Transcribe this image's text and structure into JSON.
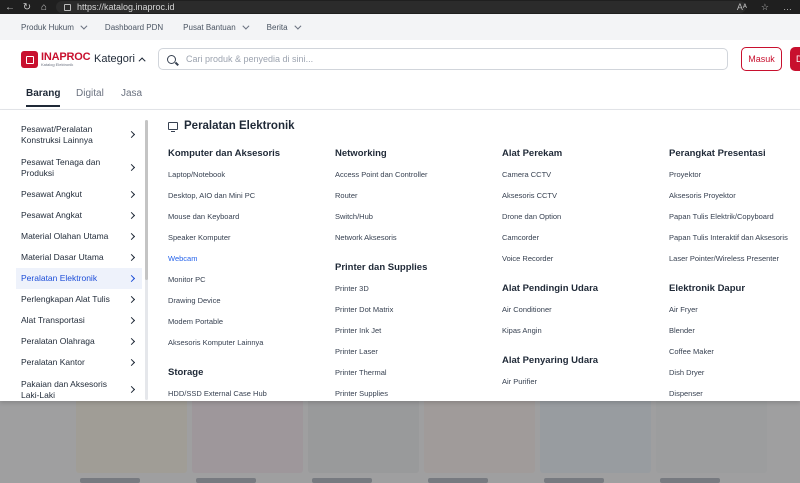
{
  "browser": {
    "url": "https://katalog.inaproc.id",
    "back_glyph": "←",
    "reload_glyph": "↻",
    "home_glyph": "⌂",
    "reader_glyph": "Aᴬ",
    "star_glyph": "☆",
    "menu_glyph": "…"
  },
  "util_nav": {
    "items": [
      {
        "label": "Produk Hukum",
        "has_dropdown": true
      },
      {
        "label": "Dashboard PDN",
        "has_dropdown": false
      },
      {
        "label": "Pusat Bantuan",
        "has_dropdown": true
      },
      {
        "label": "Berita",
        "has_dropdown": true
      }
    ]
  },
  "header": {
    "logo_text": "INAPROC",
    "logo_subtext": "Katalog Elektronik",
    "kategori_label": "Kategori",
    "search_placeholder": "Cari produk & penyedia di sini...",
    "search_value": "",
    "login_label": "Masuk",
    "register_label": "D",
    "brand_color": "#c8102e"
  },
  "tabs": [
    {
      "label": "Barang",
      "active": true
    },
    {
      "label": "Digital",
      "active": false
    },
    {
      "label": "Jasa",
      "active": false
    }
  ],
  "sidebar": {
    "items": [
      {
        "label": "Pesawat/Peralatan Konstruksi Lainnya",
        "tall": true,
        "active": false
      },
      {
        "label": "Pesawat Tenaga dan Produksi",
        "tall": true,
        "active": false
      },
      {
        "label": "Pesawat Angkut",
        "tall": false,
        "active": false
      },
      {
        "label": "Pesawat Angkat",
        "tall": false,
        "active": false
      },
      {
        "label": "Material Olahan Utama",
        "tall": false,
        "active": false
      },
      {
        "label": "Material Dasar Utama",
        "tall": false,
        "active": false
      },
      {
        "label": "Peralatan Elektronik",
        "tall": false,
        "active": true
      },
      {
        "label": "Perlengkapan Alat Tulis",
        "tall": false,
        "active": false
      },
      {
        "label": "Alat Transportasi",
        "tall": false,
        "active": false
      },
      {
        "label": "Peralatan Olahraga",
        "tall": false,
        "active": false
      },
      {
        "label": "Peralatan Kantor",
        "tall": false,
        "active": false
      },
      {
        "label": "Pakaian dan Aksesoris Laki-Laki",
        "tall": true,
        "active": false
      }
    ]
  },
  "content": {
    "title": "Peralatan Elektronik",
    "columns": [
      {
        "groups": [
          {
            "title": "Komputer dan Aksesoris",
            "items": [
              {
                "label": "Laptop/Notebook"
              },
              {
                "label": "Desktop, AIO dan Mini PC"
              },
              {
                "label": "Mouse dan Keyboard"
              },
              {
                "label": "Speaker Komputer"
              },
              {
                "label": "Webcam",
                "link": true
              },
              {
                "label": "Monitor PC"
              },
              {
                "label": "Drawing Device"
              },
              {
                "label": "Modem Portable"
              },
              {
                "label": "Aksesoris Komputer Lainnya"
              }
            ]
          },
          {
            "title": "Storage",
            "items": [
              {
                "label": "HDD/SSD External Case Hub"
              }
            ]
          }
        ]
      },
      {
        "groups": [
          {
            "title": "Networking",
            "items": [
              {
                "label": "Access Point dan Controller"
              },
              {
                "label": "Router"
              },
              {
                "label": "Switch/Hub"
              },
              {
                "label": "Network Aksesoris"
              }
            ]
          },
          {
            "title": "Printer dan Supplies",
            "items": [
              {
                "label": "Printer 3D"
              },
              {
                "label": "Printer Dot Matrix"
              },
              {
                "label": "Printer Ink Jet"
              },
              {
                "label": "Printer Laser"
              },
              {
                "label": "Printer Thermal"
              },
              {
                "label": "Printer Supplies"
              }
            ]
          }
        ]
      },
      {
        "groups": [
          {
            "title": "Alat Perekam",
            "items": [
              {
                "label": "Camera CCTV"
              },
              {
                "label": "Aksesoris CCTV"
              },
              {
                "label": "Drone dan Option"
              },
              {
                "label": "Camcorder"
              },
              {
                "label": "Voice Recorder"
              }
            ]
          },
          {
            "title": "Alat Pendingin Udara",
            "items": [
              {
                "label": "Air Conditioner"
              },
              {
                "label": "Kipas Angin"
              }
            ]
          },
          {
            "title": "Alat Penyaring Udara",
            "items": [
              {
                "label": "Air Purifier"
              }
            ]
          }
        ]
      },
      {
        "groups": [
          {
            "title": "Perangkat Presentasi",
            "items": [
              {
                "label": "Proyektor"
              },
              {
                "label": "Aksesoris Proyektor"
              },
              {
                "label": "Papan Tulis Elektrik/Copyboard"
              },
              {
                "label": "Papan Tulis Interaktif dan Aksesoris"
              },
              {
                "label": "Laser Pointer/Wireless Presenter"
              }
            ]
          },
          {
            "title": "Elektronik Dapur",
            "items": [
              {
                "label": "Air Fryer"
              },
              {
                "label": "Blender"
              },
              {
                "label": "Coffee Maker"
              },
              {
                "label": "Dish Dryer"
              },
              {
                "label": "Dispenser"
              }
            ]
          }
        ]
      }
    ]
  },
  "products": [
    {
      "color": "#f5efe0"
    },
    {
      "color": "#f1e2ec"
    },
    {
      "color": "#e7e8ea"
    },
    {
      "color": "#f6ece8"
    },
    {
      "color": "#e5eef7"
    },
    {
      "color": "#eef0f2"
    }
  ]
}
